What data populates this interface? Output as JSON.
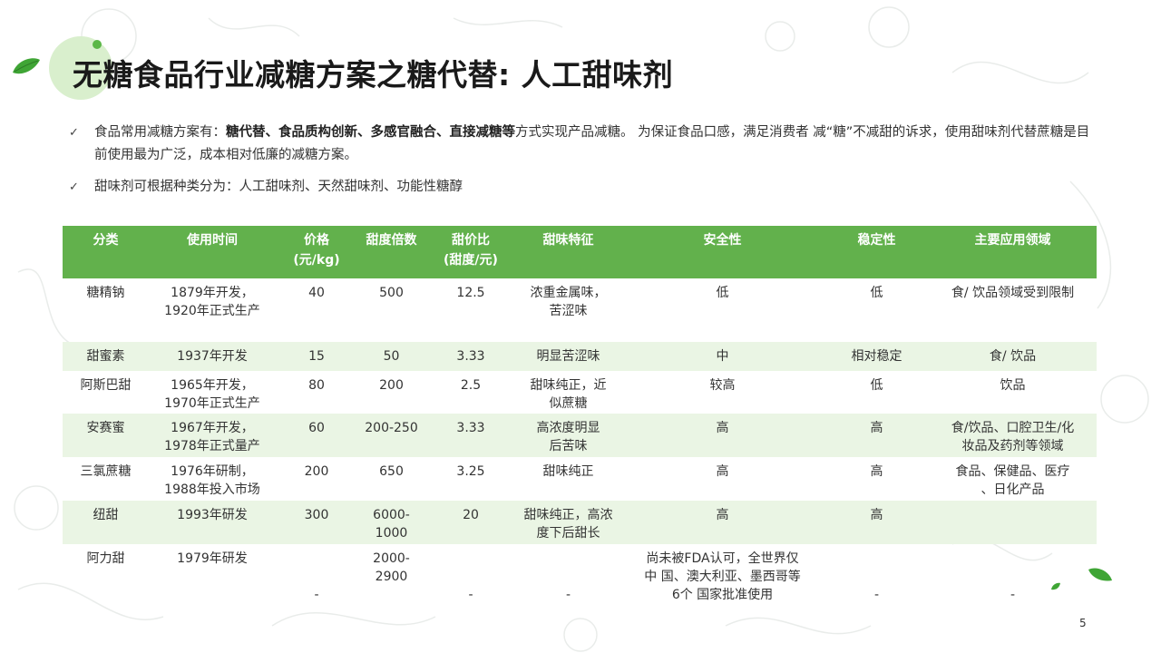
{
  "title": "无糖食品行业减糖方案之糖代替: 人工甜味剂",
  "bullets": [
    {
      "parts": [
        {
          "text": "食品常用减糖方案有：",
          "bold": false
        },
        {
          "text": "糖代替、食品质构创新、多感官融合、直接减糖等",
          "bold": true
        },
        {
          "text": "方式实现产品减糖。 为保证食品口感，满足消费者 减“糖”不减甜的诉求，使用甜味剂代替蔗糖是目前使用最为广泛，成本相对低廉的减糖方案。",
          "bold": false
        }
      ]
    },
    {
      "parts": [
        {
          "text": "甜味剂可根据种类分为：人工甜味剂、天然甜味剂、功能性糖醇",
          "bold": false
        }
      ]
    }
  ],
  "table": {
    "headers": [
      "分类",
      "使用时间",
      "价格\n(元/kg)",
      "甜度倍数",
      "甜价比\n(甜度/元)",
      "甜味特征",
      "安全性",
      "稳定性",
      "主要应用领域"
    ],
    "rows": [
      [
        "糖精钠",
        "1879年开发，\n1920年正式生产",
        "40",
        "500",
        "12.5",
        "浓重金属味，\n苦涩味",
        "低",
        "低",
        "食/ 饮品领域受到限制"
      ],
      [
        "甜蜜素",
        "1937年开发",
        "15",
        "50",
        "3.33",
        "明显苦涩味",
        "中",
        "相对稳定",
        "食/ 饮品"
      ],
      [
        "阿斯巴甜",
        "1965年开发，\n1970年正式生产",
        "80",
        "200",
        "2.5",
        "甜味纯正，近\n似蔗糖",
        "较高",
        "低",
        "饮品"
      ],
      [
        "安赛蜜",
        "1967年开发，\n1978年正式量产",
        "60",
        "200-250",
        "3.33",
        "高浓度明显\n后苦味",
        "高",
        "高",
        "食/饮品、口腔卫生/化\n妆品及药剂等领域"
      ],
      [
        "三氯蔗糖",
        "1976年研制，\n1988年投入市场",
        "200",
        "650",
        "3.25",
        "甜味纯正",
        "高",
        "高",
        "食品、保健品、医疗\n、日化产品"
      ],
      [
        "纽甜",
        "1993年研发",
        "300",
        "6000-\n1000",
        "20",
        "甜味纯正，高浓\n度下后甜长",
        "高",
        "高",
        ""
      ],
      [
        "阿力甜",
        "1979年研发",
        "\n\n-",
        "2000-\n2900",
        "\n\n-",
        "\n\n-",
        "尚未被FDA认可，全世界仅\n中 国、澳大利亚、墨西哥等\n6个 国家批准使用",
        "\n\n-",
        "\n\n-"
      ]
    ]
  },
  "page_number": "5",
  "colors": {
    "header_bg": "#62b14c",
    "alt_row_bg": "#eaf5e4",
    "accent_circle": "#d9efcd",
    "leaf_green": "#3fa535"
  },
  "icons": {
    "bullet": "check-mark-icon",
    "decor": "leaf-icon"
  }
}
